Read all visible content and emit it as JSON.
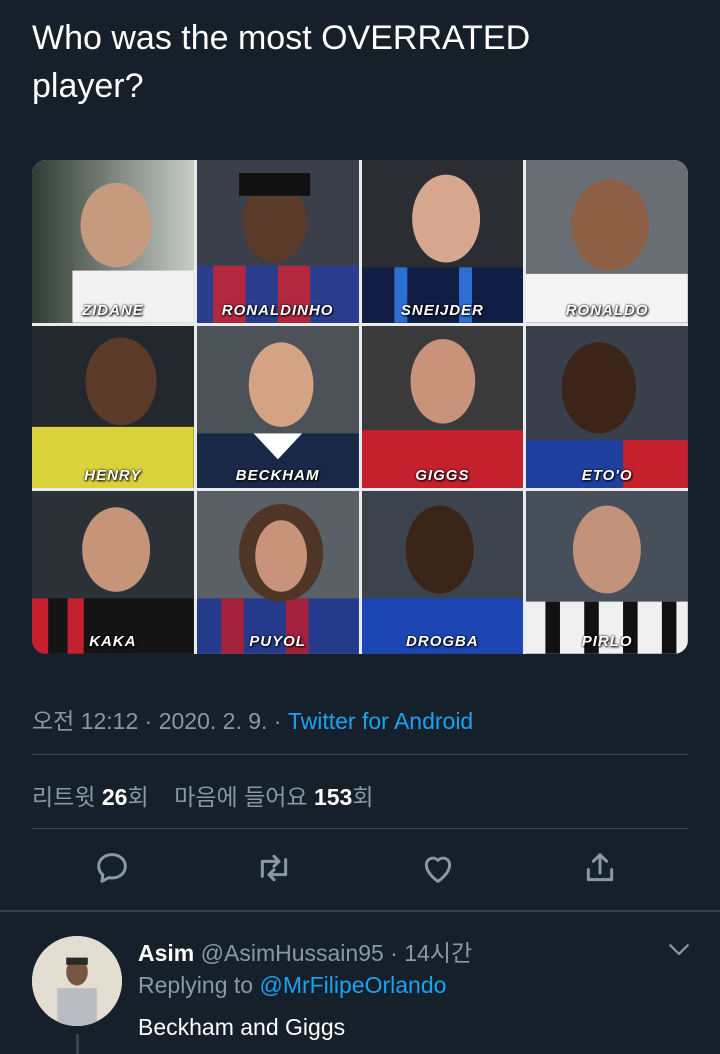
{
  "tweet": {
    "text_line1": "Who was the most OVERRATED",
    "text_line2": "player?",
    "meta_time": "오전 12:12 · 2020. 2. 9. · ",
    "meta_source": "Twitter for Android",
    "retweets_label": "리트윗 ",
    "retweets_count": "26",
    "retweets_suffix": "회",
    "likes_label": "마음에 들어요 ",
    "likes_count": "153",
    "likes_suffix": "회"
  },
  "players": [
    {
      "name": "ZIDANE"
    },
    {
      "name": "RONALDINHO"
    },
    {
      "name": "SNEIJDER"
    },
    {
      "name": "RONALDO"
    },
    {
      "name": "HENRY"
    },
    {
      "name": "BECKHAM"
    },
    {
      "name": "GIGGS"
    },
    {
      "name": "ETO'O"
    },
    {
      "name": "KAKA"
    },
    {
      "name": "PUYOL"
    },
    {
      "name": "DROGBA"
    },
    {
      "name": "PIRLO"
    }
  ],
  "reply": {
    "name": "Asim",
    "handle_time": " @AsimHussain95 · 14시간",
    "replying_prefix": "Replying to ",
    "replying_mention": "@MrFilipeOrlando",
    "body": "Beckham and Giggs"
  },
  "colors": {
    "background": "#15202b",
    "secondary_text": "#8899a6",
    "accent": "#1da1f2",
    "divider": "#38444d"
  },
  "icons": [
    "reply-icon",
    "retweet-icon",
    "like-icon",
    "share-icon",
    "chevron-down-icon"
  ]
}
